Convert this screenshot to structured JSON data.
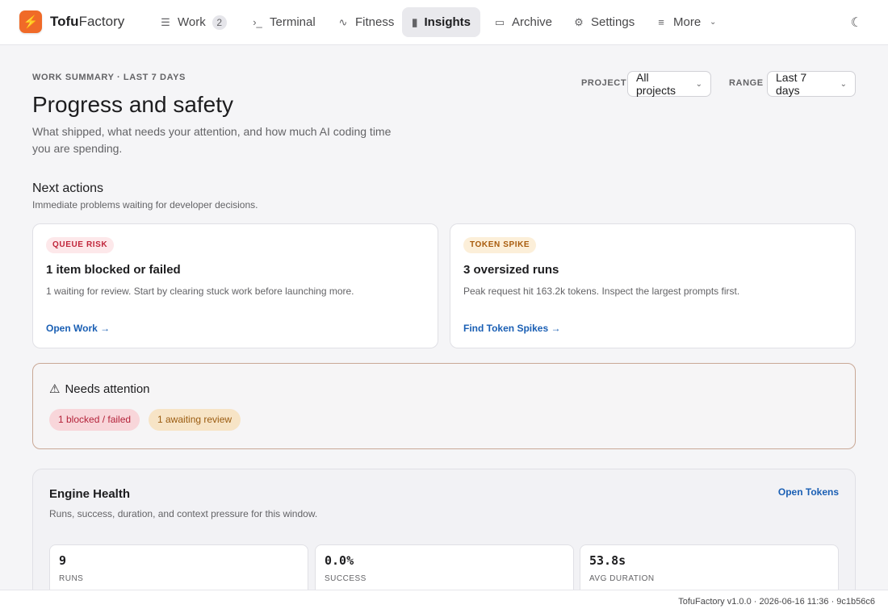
{
  "brand": {
    "bold": "Tofu",
    "light": "Factory",
    "logo_icon": "bolt-icon"
  },
  "nav": {
    "items": [
      {
        "label": "Work",
        "icon": "list-icon",
        "badge": "2"
      },
      {
        "label": "Terminal",
        "icon": "terminal-icon"
      },
      {
        "label": "Fitness",
        "icon": "pulse-icon"
      },
      {
        "label": "Insights",
        "icon": "bar-chart-icon",
        "active": true
      },
      {
        "label": "Archive",
        "icon": "archive-icon"
      },
      {
        "label": "Settings",
        "icon": "gear-icon"
      },
      {
        "label": "More",
        "icon": "menu-icon"
      }
    ]
  },
  "header": {
    "eyebrow": "WORK SUMMARY · LAST 7 DAYS",
    "title": "Progress and safety",
    "subtitle": "What shipped, what needs your attention, and how much AI coding time you are spending."
  },
  "filters": {
    "project_label": "PROJECT",
    "project_value": "All projects",
    "range_label": "RANGE",
    "range_value": "Last 7 days"
  },
  "next_actions": {
    "title": "Next actions",
    "subtitle": "Immediate problems waiting for developer decisions.",
    "cards": [
      {
        "tag": "QUEUE RISK",
        "title": "1 item blocked or failed",
        "desc": "1 waiting for review. Start by clearing stuck work before launching more.",
        "link": "Open Work →"
      },
      {
        "tag": "TOKEN SPIKE",
        "title": "3 oversized runs",
        "desc": "Peak request hit 163.2k tokens. Inspect the largest prompts first.",
        "link": "Find Token Spikes →"
      }
    ]
  },
  "attention": {
    "title": "Needs attention",
    "chips": [
      "1 blocked / failed",
      "1 awaiting review"
    ]
  },
  "engine": {
    "title": "Engine Health",
    "subtitle": "Runs, success, duration, and context pressure for this window.",
    "link": "Open Tokens",
    "stats": [
      {
        "value": "9",
        "label": "RUNS"
      },
      {
        "value": "0.0%",
        "label": "SUCCESS"
      },
      {
        "value": "53.8s",
        "label": "AVG DURATION"
      }
    ]
  },
  "footer": {
    "text": "TofuFactory v1.0.0 · 2026-06-16 11:36 · 9c1b56c6"
  },
  "colors": {
    "accent": "#f06a28",
    "link": "#1a5fb4",
    "danger": "#c0263b",
    "warning": "#a85b0c"
  }
}
